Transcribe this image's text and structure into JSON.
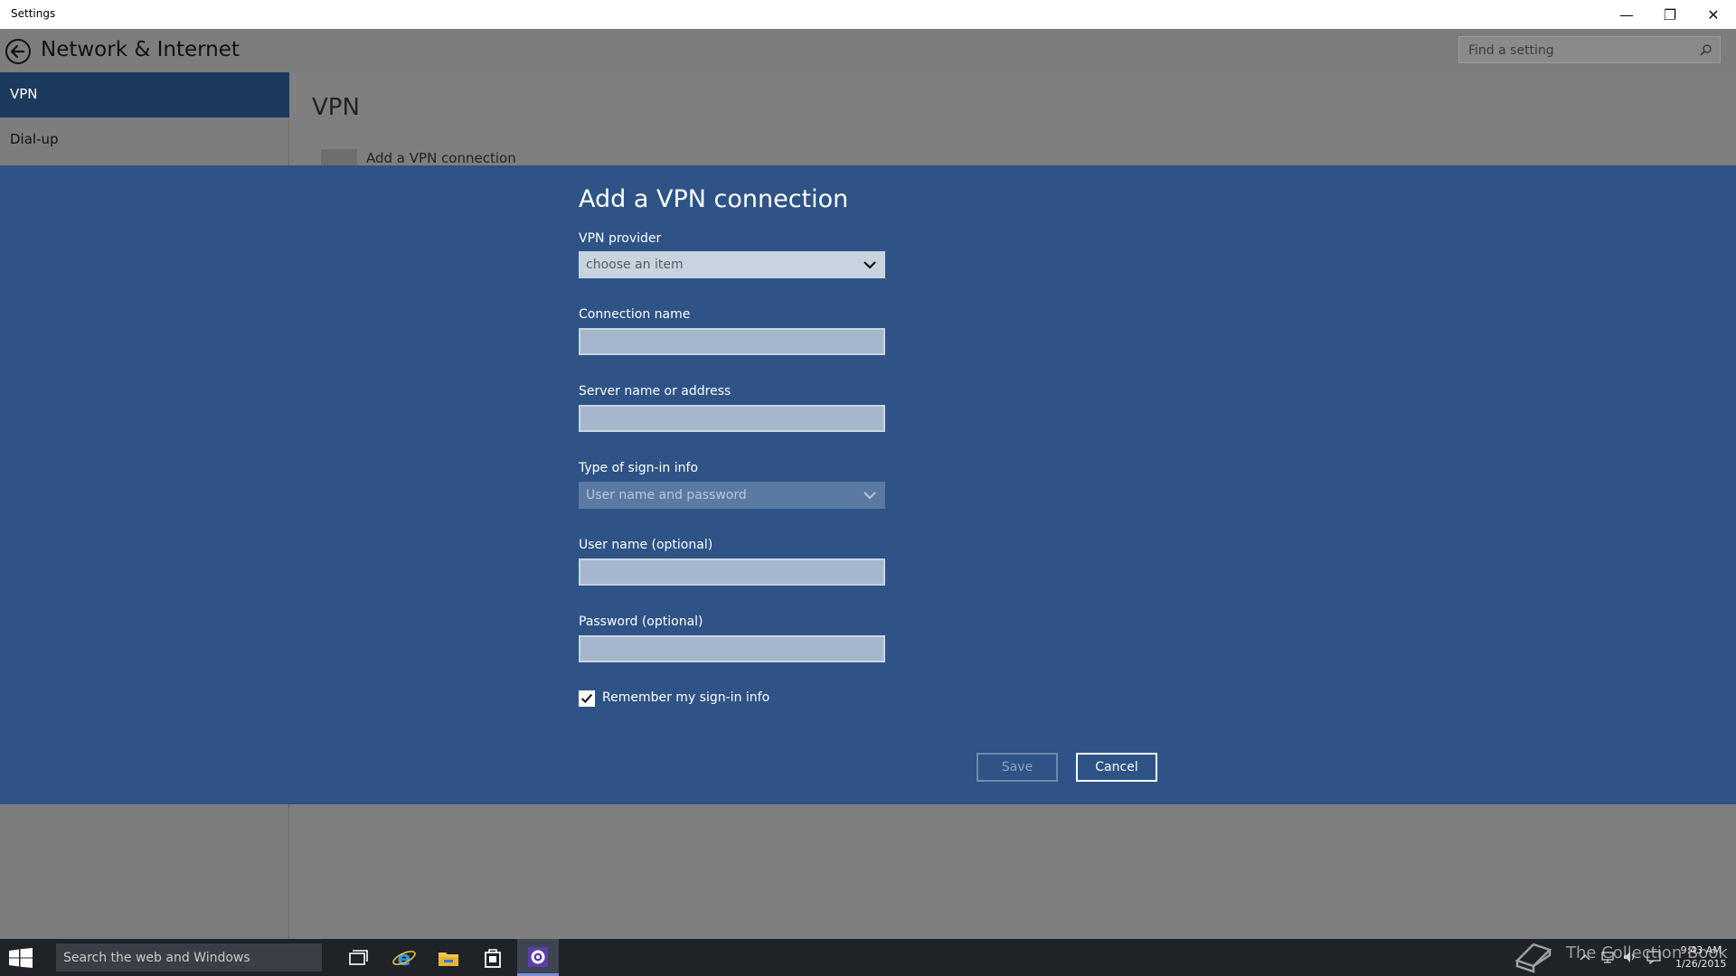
{
  "window": {
    "title": "Settings",
    "controls": {
      "minimize": "—",
      "restore": "❐",
      "close": "✕"
    }
  },
  "header": {
    "title": "Network & Internet",
    "search_placeholder": "Find a setting"
  },
  "sidebar": {
    "items": [
      {
        "label": "VPN",
        "active": true
      },
      {
        "label": "Dial-up",
        "active": false
      }
    ]
  },
  "content": {
    "heading": "VPN",
    "add_connection_label": "Add a VPN connection"
  },
  "dialog": {
    "title": "Add a VPN connection",
    "vpn_provider": {
      "label": "VPN provider",
      "value": "choose an item"
    },
    "connection_name": {
      "label": "Connection name",
      "value": ""
    },
    "server": {
      "label": "Server name or address",
      "value": ""
    },
    "signin_type": {
      "label": "Type of sign-in info",
      "value": "User name and password",
      "disabled": true
    },
    "username": {
      "label": "User name (optional)",
      "value": ""
    },
    "password": {
      "label": "Password (optional)",
      "value": ""
    },
    "remember": {
      "label": "Remember my sign-in info",
      "checked": true
    },
    "save_label": "Save",
    "cancel_label": "Cancel"
  },
  "taskbar": {
    "search_placeholder": "Search the web and Windows",
    "apps": [
      "task-view-icon",
      "internet-explorer-icon",
      "file-explorer-icon",
      "store-icon",
      "settings-icon"
    ],
    "watermark_text": "The Collection Book",
    "clock": {
      "time": "9:43 AM",
      "date": "1/26/2015"
    }
  },
  "colors": {
    "dialog_bg": "#2e5386",
    "sidebar_active": "#1b3a5e",
    "overlay_gray": "#7f7f7f",
    "taskbar": "#1f2227"
  }
}
